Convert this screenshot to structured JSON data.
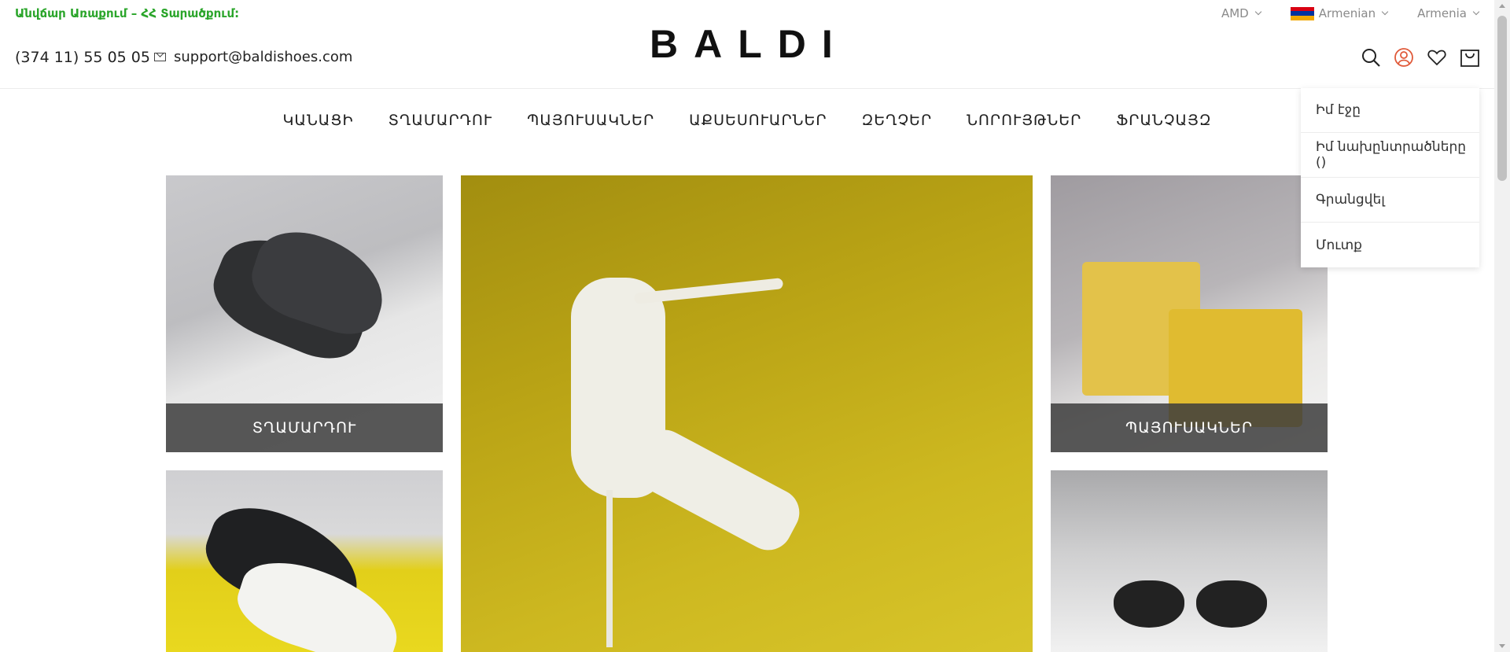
{
  "promo": "Անվճար Առաքում – ՀՀ Տարածքում:",
  "selectors": {
    "currency": "AMD",
    "language": "Armenian",
    "country": "Armenia"
  },
  "contact": {
    "phone": "(374 11) 55 05 05",
    "email": "support@baldishoes.com"
  },
  "logo": "BALDI",
  "nav": [
    "ԿԱՆԱՑԻ",
    "ՏՂԱՄԱՐԴՈՒ",
    "ՊԱՅՈՒՍԱԿՆԵՐ",
    "ԱՔՍԵՍՈՒԱՐՆԵՐ",
    "ԶԵՂՉԵՐ",
    "ՆՈՐՈՒՅԹՆԵՐ",
    "ՖՐԱՆՉԱՅԶ"
  ],
  "account_menu": [
    "Իմ էջը",
    "Իմ նախընտրածները ()",
    "Գրանցվել",
    "Մուտք"
  ],
  "tiles": {
    "men": "ՏՂԱՄԱՐԴՈՒ",
    "bags": "ՊԱՅՈՒՍԱԿՆԵՐ"
  },
  "colors": {
    "promo_green": "#2aa52a",
    "user_icon_accent": "#e05a3a"
  },
  "icons": [
    "search-icon",
    "user-icon",
    "heart-icon",
    "cart-icon",
    "envelope-icon",
    "flag-armenia-icon"
  ]
}
